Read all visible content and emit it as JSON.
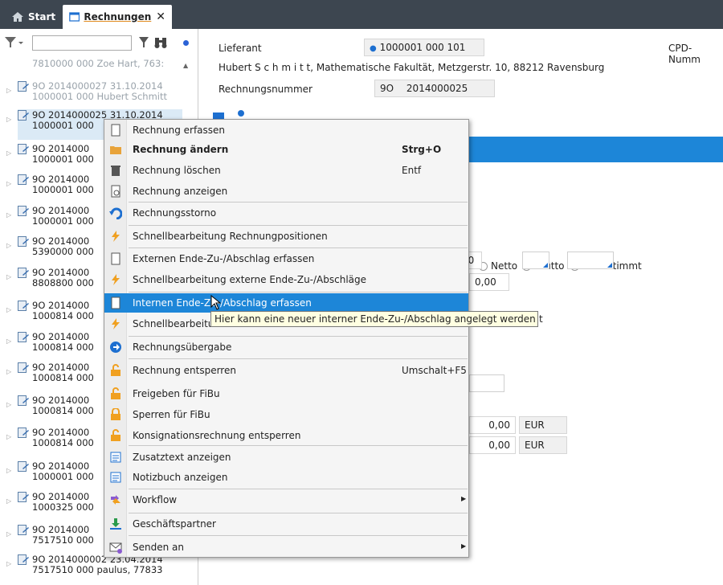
{
  "tabs": {
    "start_label": "Start",
    "rechnungen_label": "Rechnungen",
    "close_glyph": "✕"
  },
  "left_panel": {
    "search_value": "",
    "items": [
      {
        "l1": "7810000 000 Zoe Hart, 763:",
        "l2": "",
        "faded": true
      },
      {
        "l1": "9O 2014000027 31.10.2014",
        "l2": "1000001 000 Hubert Schmitt",
        "faded": true
      },
      {
        "l1": "9O 2014000025 31.10.2014",
        "l2": "1000001 000",
        "selected": true
      },
      {
        "l1": "9O 2014000",
        "l2": "1000001 000"
      },
      {
        "l1": "9O 2014000",
        "l2": "1000001 000"
      },
      {
        "l1": "9O 2014000",
        "l2": "1000001 000"
      },
      {
        "l1": "9O 2014000",
        "l2": "5390000 000"
      },
      {
        "l1": "9O 2014000",
        "l2": "8808800 000"
      },
      {
        "l1": "9O 2014000",
        "l2": "1000814 000"
      },
      {
        "l1": "9O 2014000",
        "l2": "1000814 000"
      },
      {
        "l1": "9O 2014000",
        "l2": "1000814 000"
      },
      {
        "l1": "9O 2014000",
        "l2": "1000814 000"
      },
      {
        "l1": "9O 2014000",
        "l2": "1000814 000"
      },
      {
        "l1": "9O 2014000",
        "l2": "1000001 000"
      },
      {
        "l1": "9O 2014000",
        "l2": "1000325 000"
      },
      {
        "l1": "9O 2014000",
        "l2": "7517510 000"
      },
      {
        "l1": "9O 2014000002 23.04.2014",
        "l2": "7517510 000 paulus, 77833"
      }
    ]
  },
  "content": {
    "lieferant_label": "Lieferant",
    "lieferant_value": "1000001 000 101",
    "cpd_label": "CPD-Numm",
    "address": "Hubert S c h m i t t, Mathematische Fakultät, Metzgerstr. 10, 88212 Ravensburg",
    "rechnungsnummer_label": "Rechnungsnummer",
    "rechnungsnummer_prefix": "9O",
    "rechnungsnummer_value": "2014000025",
    "radio_netto": "Netto",
    "radio_brutto": "Brutto",
    "radio_unbestimmt": "Unbestimmt",
    "partial_value_1": "00",
    "value_2": "0,00",
    "value_3": "0,00",
    "currency_3": "EUR",
    "value_4": "0,00",
    "currency_4": "EUR",
    "partial_t": "t"
  },
  "context_menu": {
    "items": [
      {
        "label": "Rechnung erfassen",
        "shortcut": "",
        "icon": "document-icon"
      },
      {
        "label": "Rechnung ändern",
        "shortcut": "Strg+O",
        "icon": "folder-open-icon",
        "bold": true
      },
      {
        "label": "Rechnung löschen",
        "shortcut": "Entf",
        "icon": "trash-icon"
      },
      {
        "label": "Rechnung anzeigen",
        "shortcut": "",
        "icon": "document-view-icon"
      },
      {
        "label": "Rechnungsstorno",
        "shortcut": "",
        "icon": "undo-icon"
      },
      {
        "label": "Schnellbearbeitung Rechnungpositionen",
        "shortcut": "",
        "icon": "lightning-icon"
      },
      {
        "label": "Externen Ende-Zu-/Abschlag erfassen",
        "shortcut": "",
        "icon": "document-icon"
      },
      {
        "label": "Schnellbearbeitung externe Ende-Zu-/Abschläge",
        "shortcut": "",
        "icon": "lightning-icon"
      },
      {
        "label": "Internen Ende-Zu-/Abschlag erfassen",
        "shortcut": "",
        "icon": "document-icon",
        "highlighted": true
      },
      {
        "label": "Schnellbearbeitu",
        "shortcut": "",
        "icon": "lightning-icon"
      },
      {
        "label": "Rechnungsübergabe",
        "shortcut": "",
        "icon": "arrow-right-circle-icon"
      },
      {
        "label": "Rechnung entsperren",
        "shortcut": "Umschalt+F5",
        "icon": "unlock-icon"
      },
      {
        "label": "Freigeben für FiBu",
        "shortcut": "",
        "icon": "unlock-icon"
      },
      {
        "label": "Sperren für FiBu",
        "shortcut": "",
        "icon": "lock-icon"
      },
      {
        "label": "Konsignationsrechnung entsperren",
        "shortcut": "",
        "icon": "unlock-icon"
      },
      {
        "label": "Zusatztext anzeigen",
        "shortcut": "",
        "icon": "notes-icon"
      },
      {
        "label": "Notizbuch anzeigen",
        "shortcut": "",
        "icon": "notes-icon"
      },
      {
        "label": "Workflow",
        "shortcut": "",
        "icon": "workflow-icon",
        "submenu": true
      },
      {
        "label": "Geschäftspartner",
        "shortcut": "",
        "icon": "download-icon"
      },
      {
        "label": "Senden an",
        "shortcut": "",
        "icon": "send-icon",
        "submenu": true
      }
    ]
  },
  "tooltip": "Hier kann eine neuer interner Ende-Zu-/Abschlag angelegt werden",
  "colors": {
    "topbar": "#3d4650",
    "accent_blue": "#1d86d8",
    "selection": "#dbeaf6",
    "tooltip_bg": "#ffffe1"
  }
}
